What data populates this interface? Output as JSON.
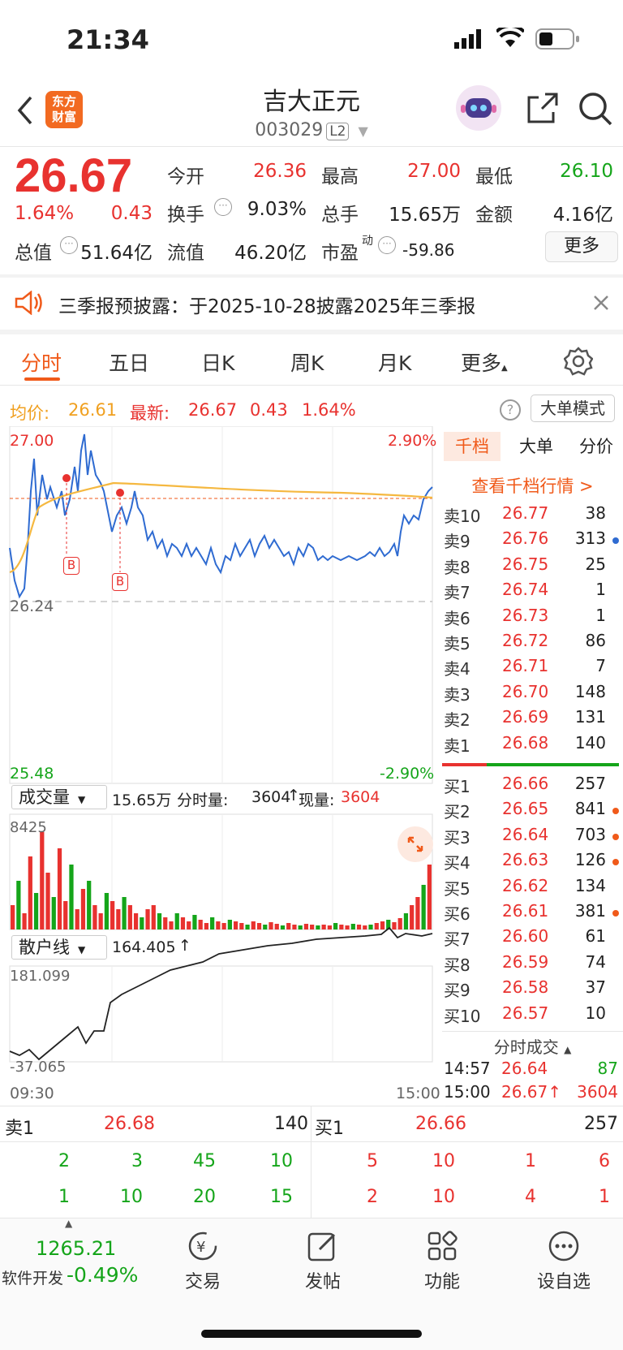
{
  "status": {
    "time": "21:34"
  },
  "header": {
    "title": "吉大正元",
    "code": "003029",
    "level": "L2",
    "logo_text_line1": "东方",
    "logo_text_line2": "财富"
  },
  "quote": {
    "price": "26.67",
    "change_pct": "1.64%",
    "change": "0.43",
    "open_label": "今开",
    "open": "26.36",
    "high_label": "最高",
    "high": "27.00",
    "low_label": "最低",
    "low": "26.10",
    "turnover_label": "换手",
    "turnover": "9.03%",
    "volume_label": "总手",
    "volume": "15.65万",
    "amount_label": "金额",
    "amount": "4.16亿",
    "mktcap_label": "总值",
    "mktcap": "51.64亿",
    "float_label": "流值",
    "float": "46.20亿",
    "pe_label": "市盈",
    "pe_sup": "动",
    "pe": "-59.86",
    "more_label": "更多"
  },
  "notice": {
    "text": "三季报预披露：于2025-10-28披露2025年三季报"
  },
  "tabs": [
    "分时",
    "五日",
    "日K",
    "周K",
    "月K",
    "更多"
  ],
  "info": {
    "avg_label": "均价:",
    "avg": "26.61",
    "latest_label": "最新:",
    "latest": "26.67",
    "latest_chg": "0.43",
    "latest_pct": "1.64%",
    "mode_label": "大单模式"
  },
  "chart_labels": {
    "price_top": "27.00",
    "price_mid": "26.24",
    "price_bot": "25.48",
    "pct_top": "2.90%",
    "pct_bot": "-2.90%",
    "vol_indicator": "成交量",
    "vol_total": "15.65万",
    "vol_tick_label": "分时量:",
    "vol_tick": "3604",
    "vol_now_label": "现量:",
    "vol_now": "3604",
    "vol_max": "8425",
    "retail_indicator": "散户线",
    "retail_val": "164.405",
    "retail_max": "181.099",
    "retail_min": "-37.065",
    "time_start": "09:30",
    "time_end": "15:00",
    "marker_b": "B"
  },
  "orderbook": {
    "tabs": [
      "千档",
      "大单",
      "分价"
    ],
    "link": "查看千档行情 >",
    "asks": [
      {
        "label": "卖10",
        "price": "26.77",
        "vol": "38",
        "dot": ""
      },
      {
        "label": "卖9",
        "price": "26.76",
        "vol": "313",
        "dot": "#2f6bd1"
      },
      {
        "label": "卖8",
        "price": "26.75",
        "vol": "25",
        "dot": ""
      },
      {
        "label": "卖7",
        "price": "26.74",
        "vol": "1",
        "dot": ""
      },
      {
        "label": "卖6",
        "price": "26.73",
        "vol": "1",
        "dot": ""
      },
      {
        "label": "卖5",
        "price": "26.72",
        "vol": "86",
        "dot": ""
      },
      {
        "label": "卖4",
        "price": "26.71",
        "vol": "7",
        "dot": ""
      },
      {
        "label": "卖3",
        "price": "26.70",
        "vol": "148",
        "dot": ""
      },
      {
        "label": "卖2",
        "price": "26.69",
        "vol": "131",
        "dot": ""
      },
      {
        "label": "卖1",
        "price": "26.68",
        "vol": "140",
        "dot": ""
      }
    ],
    "bids": [
      {
        "label": "买1",
        "price": "26.66",
        "vol": "257",
        "dot": ""
      },
      {
        "label": "买2",
        "price": "26.65",
        "vol": "841",
        "dot": "#f05a1a"
      },
      {
        "label": "买3",
        "price": "26.64",
        "vol": "703",
        "dot": "#f05a1a"
      },
      {
        "label": "买4",
        "price": "26.63",
        "vol": "126",
        "dot": "#f05a1a"
      },
      {
        "label": "买5",
        "price": "26.62",
        "vol": "134",
        "dot": ""
      },
      {
        "label": "买6",
        "price": "26.61",
        "vol": "381",
        "dot": "#f05a1a"
      },
      {
        "label": "买7",
        "price": "26.60",
        "vol": "61",
        "dot": ""
      },
      {
        "label": "买8",
        "price": "26.59",
        "vol": "74",
        "dot": ""
      },
      {
        "label": "买9",
        "price": "26.58",
        "vol": "37",
        "dot": ""
      },
      {
        "label": "买10",
        "price": "26.57",
        "vol": "10",
        "dot": ""
      }
    ],
    "ticks_title": "分时成交",
    "ticks": [
      {
        "time": "14:57",
        "price": "26.64",
        "vol": "87",
        "color": "#15a51a"
      },
      {
        "time": "15:00",
        "price": "26.67↑",
        "vol": "3604",
        "color": "#e8322f"
      }
    ]
  },
  "bottom_stats": {
    "sell_label": "卖1",
    "sell_price": "26.68",
    "sell_vol": "140",
    "buy_label": "买1",
    "buy_price": "26.66",
    "buy_vol": "257",
    "left_row1": [
      "2",
      "3",
      "45",
      "10"
    ],
    "left_row2": [
      "1",
      "10",
      "20",
      "15"
    ],
    "right_row1": [
      "5",
      "10",
      "1",
      "6"
    ],
    "right_row2": [
      "2",
      "10",
      "4",
      "1"
    ]
  },
  "bottom_nav": {
    "index_value": "1265.21",
    "index_name": "软件开发",
    "index_pct": "-0.49%",
    "items": [
      "交易",
      "发帖",
      "功能",
      "设自选"
    ]
  },
  "colors": {
    "up": "#e8322f",
    "down": "#15a51a",
    "accent": "#f05a1a",
    "price_line": "#2f6bd1",
    "avg_line": "#f5b840"
  }
}
